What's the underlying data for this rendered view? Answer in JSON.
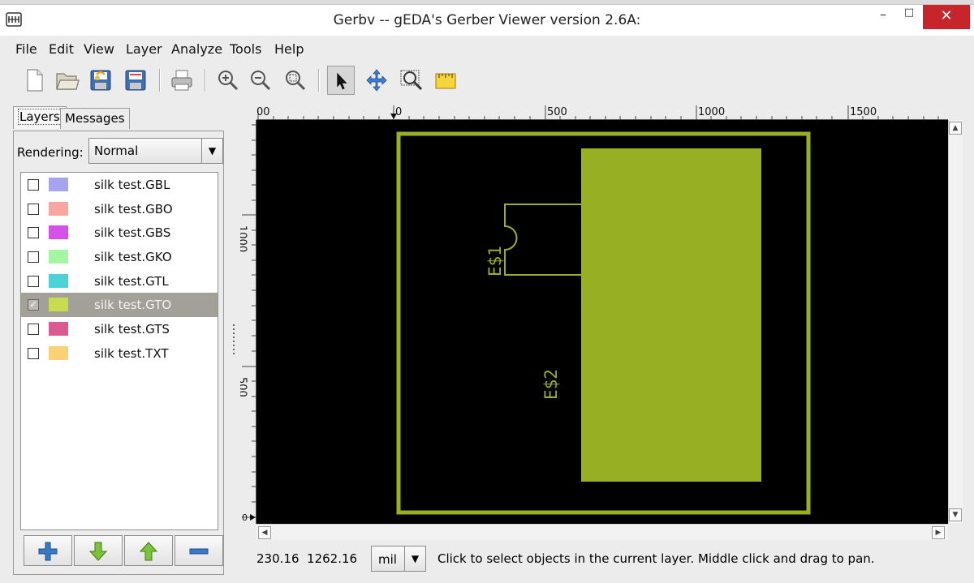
{
  "window": {
    "title": "Gerbv -- gEDA's Gerber Viewer version 2.6A:",
    "minimize": "–",
    "maximize": "□",
    "close": "✕",
    "app_icon": "gerbv-icon"
  },
  "menubar": {
    "items": [
      "File",
      "Edit",
      "View",
      "Layer",
      "Analyze",
      "Tools",
      "Help"
    ]
  },
  "toolbar": {
    "icons": [
      "new-file-icon",
      "open-folder-icon",
      "revert-icon",
      "save-icon",
      "print-icon",
      "zoom-in-icon",
      "zoom-out-icon",
      "zoom-fit-icon",
      "pointer-tool-icon",
      "pan-tool-icon",
      "zoom-tool-icon",
      "measure-tool-icon"
    ],
    "active_tool": "pointer-tool-icon"
  },
  "sidebar": {
    "tabs": [
      "Layers",
      "Messages"
    ],
    "active_tab": "Layers",
    "rendering_label": "Rendering:",
    "rendering_value": "Normal",
    "layers": [
      {
        "name": "silk test.GBL",
        "color": "#a7a3ee",
        "checked": false,
        "selected": false
      },
      {
        "name": "silk test.GBO",
        "color": "#f8a6a0",
        "checked": false,
        "selected": false
      },
      {
        "name": "silk test.GBS",
        "color": "#d651e8",
        "checked": false,
        "selected": false
      },
      {
        "name": "silk test.GKO",
        "color": "#a4f6a2",
        "checked": false,
        "selected": false
      },
      {
        "name": "silk test.GTL",
        "color": "#4cd3d6",
        "checked": false,
        "selected": false
      },
      {
        "name": "silk test.GTO",
        "color": "#c8dc52",
        "checked": true,
        "selected": true
      },
      {
        "name": "silk test.GTS",
        "color": "#dc5a92",
        "checked": false,
        "selected": false
      },
      {
        "name": "silk test.TXT",
        "color": "#fbd176",
        "checked": false,
        "selected": false
      }
    ],
    "buttons": [
      "add-layer-icon",
      "move-layer-down-icon",
      "move-layer-up-icon",
      "remove-layer-icon"
    ]
  },
  "rulers": {
    "horizontal_labels": [
      "00",
      "0",
      "500",
      "1000",
      "1500"
    ],
    "vertical_labels": [
      "1000",
      "500",
      "0"
    ]
  },
  "canvas": {
    "silk_color": "#97b023",
    "component_labels": [
      "E$1",
      "E$2"
    ]
  },
  "statusbar": {
    "coords": "230.16  1262.16",
    "units": "mil",
    "message": "Click to select objects in the current layer. Middle click and drag to pan."
  }
}
